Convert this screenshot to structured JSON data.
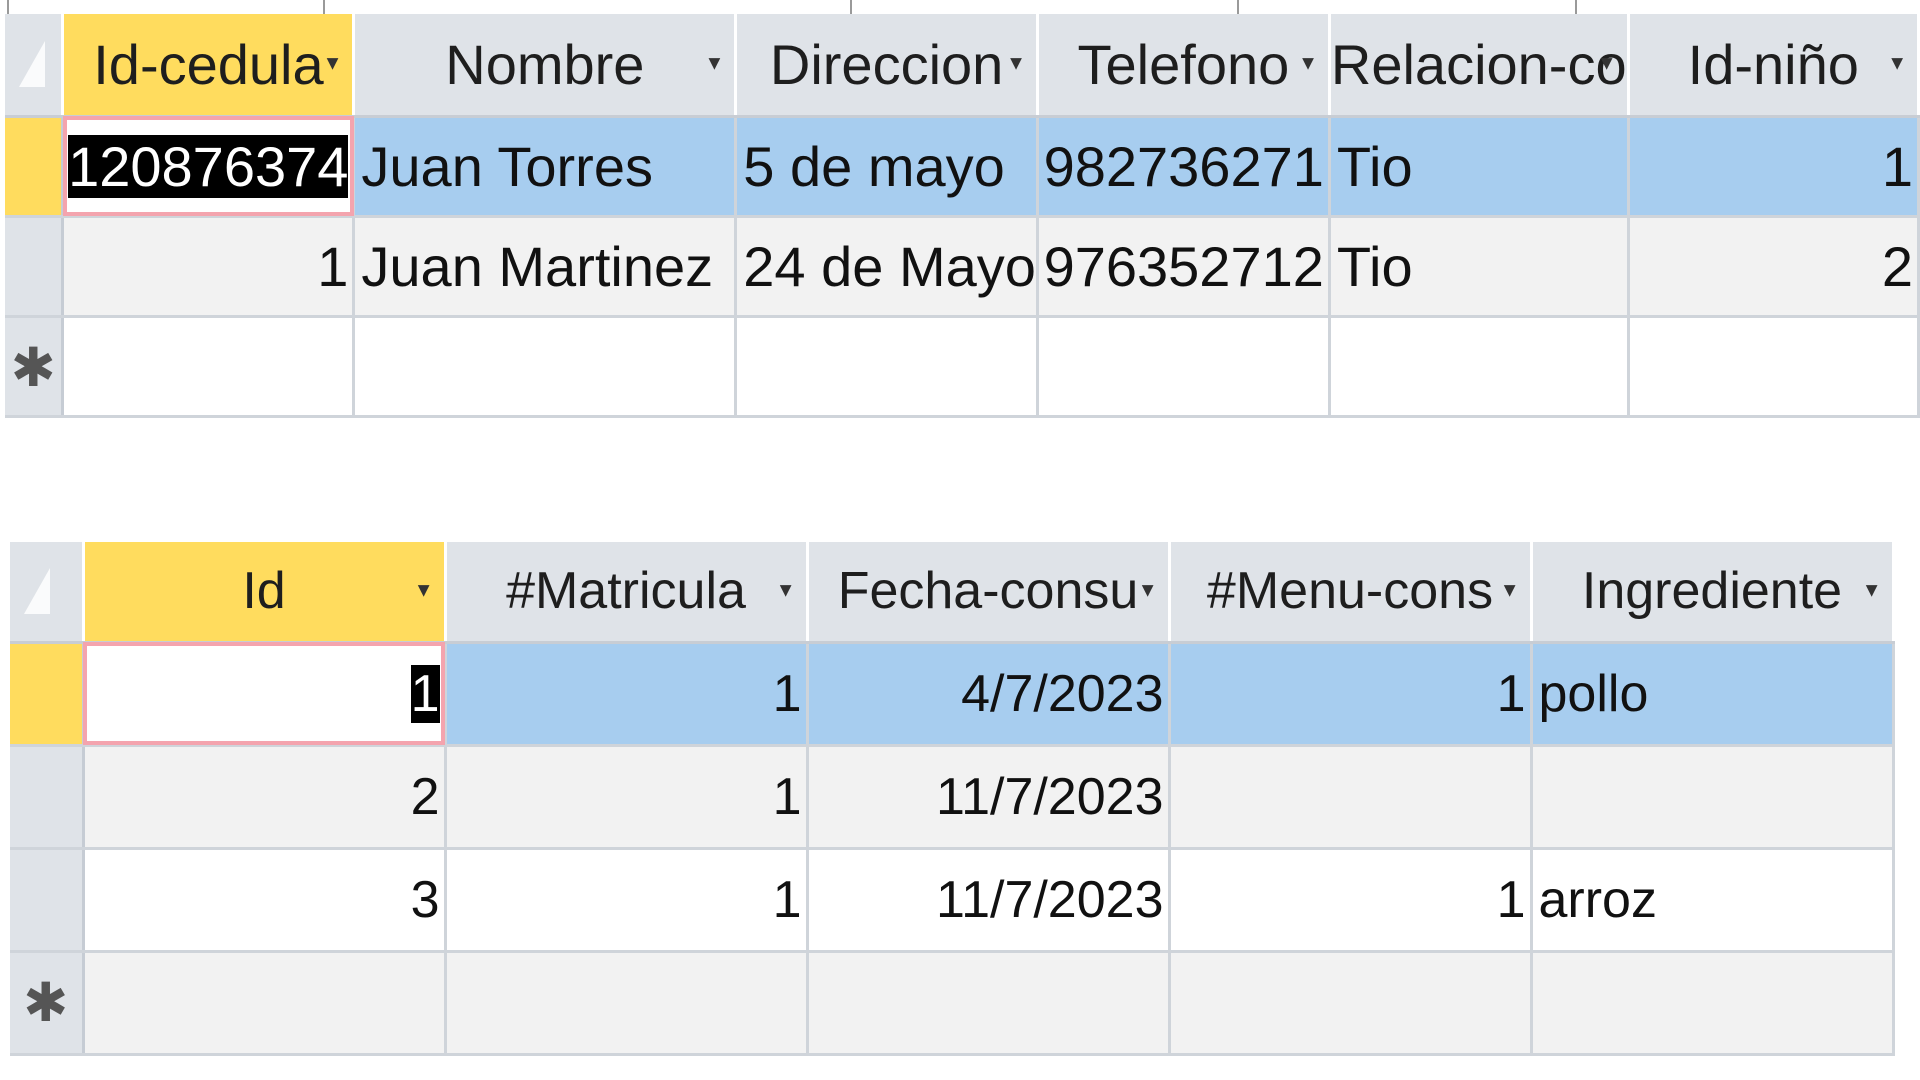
{
  "table1": {
    "columns": [
      "Id-cedula",
      "Nombre",
      "Direccion",
      "Telefono",
      "Relacion-co",
      "Id-niño"
    ],
    "rows": [
      {
        "id_cedula": "120876374",
        "nombre": "Juan Torres",
        "direccion": "5 de mayo",
        "telefono": "982736271",
        "relacion": "Tio",
        "id_nino": "1"
      },
      {
        "id_cedula": "1",
        "nombre": "Juan Martinez",
        "direccion": "24 de Mayo",
        "telefono": "976352712",
        "relacion": "Tio",
        "id_nino": "2"
      }
    ],
    "new_row_marker": "✱"
  },
  "table2": {
    "columns": [
      "Id",
      "#Matricula",
      "Fecha-consu",
      "#Menu-cons",
      "Ingrediente"
    ],
    "rows": [
      {
        "id": "1",
        "matricula": "1",
        "fecha": "4/7/2023",
        "menu": "1",
        "ingrediente": "pollo"
      },
      {
        "id": "2",
        "matricula": "1",
        "fecha": "11/7/2023",
        "menu": "",
        "ingrediente": ""
      },
      {
        "id": "3",
        "matricula": "1",
        "fecha": "11/7/2023",
        "menu": "1",
        "ingrediente": "arroz"
      }
    ],
    "new_row_marker": "✱"
  },
  "colors": {
    "header_bg": "#dfe3e8",
    "active_header": "#ffdc5e",
    "selected_row": "#a7cdef",
    "alt_row": "#f2f2f2",
    "edit_border": "#f4a4ae"
  },
  "icons": {
    "sort_filter": "dropdown-arrow-icon",
    "new_record": "asterisk-icon",
    "select_all": "select-all-icon"
  }
}
